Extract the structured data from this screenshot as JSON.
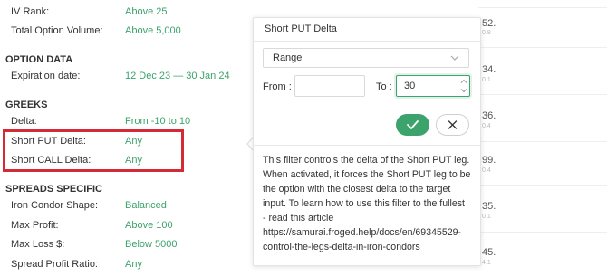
{
  "filters": {
    "top_rows": [
      {
        "label": "IV Rank:",
        "value": "Above 25"
      },
      {
        "label": "Total Option Volume:",
        "value": "Above 5,000"
      }
    ],
    "option_data": {
      "heading": "OPTION DATA",
      "rows": [
        {
          "label": "Expiration date:",
          "value": "12 Dec 23 — 30 Jan 24"
        }
      ]
    },
    "greeks": {
      "heading": "GREEKS",
      "rows": [
        {
          "label": "Delta:",
          "value": "From -10 to 10"
        },
        {
          "label": "Short PUT Delta:",
          "value": "Any"
        },
        {
          "label": "Short CALL Delta:",
          "value": "Any"
        }
      ]
    },
    "spreads": {
      "heading": "SPREADS SPECIFIC",
      "rows": [
        {
          "label": "Iron Condor Shape:",
          "value": "Balanced"
        },
        {
          "label": "Max Profit:",
          "value": "Above 100"
        },
        {
          "label": "Max Loss $:",
          "value": "Below 5000"
        },
        {
          "label": "Spread Profit Ratio:",
          "value": "Any"
        }
      ]
    }
  },
  "background_table": {
    "values": [
      "52.",
      "34.",
      "36.",
      "99.",
      "35.",
      "45."
    ],
    "subvalues": [
      "0.8",
      "0.1",
      "0.4",
      "0.4",
      "0.1",
      "4.1"
    ]
  },
  "popover": {
    "title": "Short PUT Delta",
    "mode_select": "Range",
    "from_label": "From :",
    "from_value": "",
    "to_label": "To :",
    "to_value": "30",
    "description_lines": [
      "This filter controls the delta of the Short PUT leg.",
      "When activated, it forces the Short PUT leg to be",
      "the option with the closest delta to the target",
      "input. To learn how to use this filter to the fullest",
      "- read this article",
      "https://samurai.froged.help/docs/en/69345529-",
      "control-the-legs-delta-in-iron-condors"
    ]
  },
  "colors": {
    "accent_green": "#3ba36b",
    "highlight_red": "#d42a36"
  }
}
